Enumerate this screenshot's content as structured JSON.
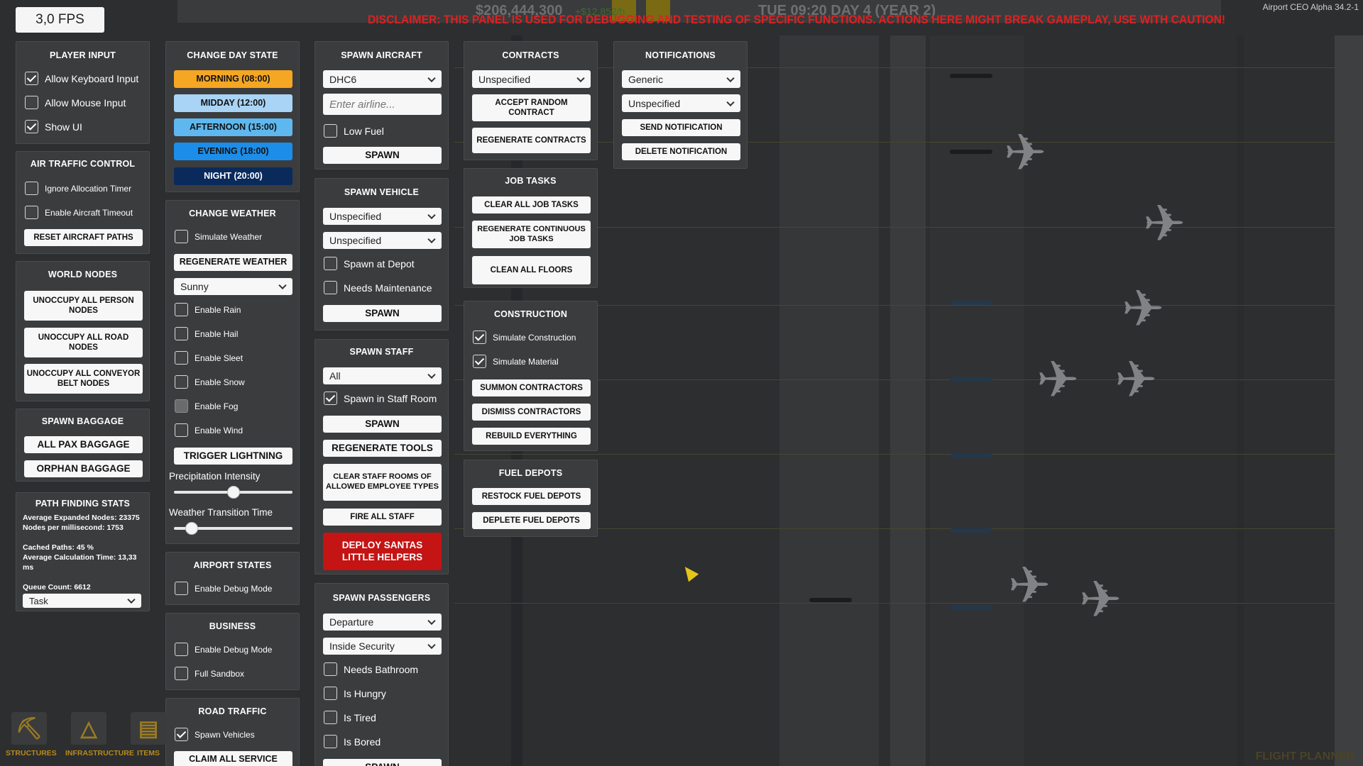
{
  "fps": "3,0 FPS",
  "hud": {
    "money": "$206,444,300",
    "income": "+$12,852/h",
    "time": "TUE  09:20  DAY 4 (YEAR 2)",
    "version": "Airport CEO Alpha 34.2-1",
    "disclaimer": "DISCLAIMER: THIS PANEL IS USED FOR DEBUGGING AND TESTING OF SPECIFIC FUNCTIONS. ACTIONS HERE MIGHT BREAK GAMEPLAY, USE WITH CAUTION!"
  },
  "player_input": {
    "title": "PLAYER INPUT",
    "allow_keyboard": "Allow Keyboard Input",
    "allow_mouse": "Allow Mouse Input",
    "show_ui": "Show UI"
  },
  "atc": {
    "title": "AIR TRAFFIC CONTROL",
    "ignore_timer": "Ignore Allocation Timer",
    "enable_timeout": "Enable Aircraft Timeout",
    "reset_paths": "RESET AIRCRAFT PATHS"
  },
  "world_nodes": {
    "title": "WORLD NODES",
    "person": "UNOCCUPY ALL PERSON NODES",
    "road": "UNOCCUPY ALL ROAD NODES",
    "conveyor": "UNOCCUPY ALL CONVEYOR BELT NODES"
  },
  "spawn_baggage": {
    "title": "SPAWN BAGGAGE",
    "all_pax": "ALL PAX BAGGAGE",
    "orphan": "ORPHAN BAGGAGE"
  },
  "pathfinding": {
    "title": "PATH FINDING STATS",
    "expanded": "Average Expanded Nodes: 23375",
    "per_ms": "Nodes per millisecond: 1753",
    "cached": "Cached Paths: 45 %",
    "calc_time_1": "Average Calculation Time: 13,33",
    "calc_time_2": "ms",
    "queue": "Queue Count: 6612",
    "dropdown": "Task"
  },
  "day_state": {
    "title": "CHANGE DAY STATE",
    "morning": "MORNING  (08:00)",
    "midday": "MIDDAY  (12:00)",
    "afternoon": "AFTERNOON  (15:00)",
    "evening": "EVENING  (18:00)",
    "night": "NIGHT (20:00)"
  },
  "weather": {
    "title": "CHANGE WEATHER",
    "simulate": "Simulate Weather",
    "regenerate": "REGENERATE WEATHER",
    "dropdown": "Sunny",
    "rain": "Enable Rain",
    "hail": "Enable Hail",
    "sleet": "Enable Sleet",
    "snow": "Enable Snow",
    "fog": "Enable Fog",
    "wind": "Enable Wind",
    "lightning": "TRIGGER LIGHTNING",
    "precip_label": "Precipitation Intensity",
    "precip_value": 0.5,
    "transition_label": "Weather Transition Time",
    "transition_value": 0.15
  },
  "airport_states": {
    "title": "AIRPORT STATES",
    "debug": "Enable Debug Mode"
  },
  "business": {
    "title": "BUSINESS",
    "debug": "Enable Debug Mode",
    "sandbox": "Full Sandbox"
  },
  "road_traffic": {
    "title": "ROAD TRAFFIC",
    "spawn_vehicles": "Spawn Vehicles",
    "claim": "CLAIM ALL SERVICE"
  },
  "spawn_aircraft": {
    "title": "SPAWN AIRCRAFT",
    "dropdown": "DHC6",
    "placeholder": "Enter airline...",
    "low_fuel": "Low Fuel",
    "spawn": "SPAWN"
  },
  "spawn_vehicle": {
    "title": "SPAWN VEHICLE",
    "dropdown1": "Unspecified",
    "dropdown2": "Unspecified",
    "at_depot": "Spawn at Depot",
    "maintenance": "Needs Maintenance",
    "spawn": "SPAWN"
  },
  "spawn_staff": {
    "title": "SPAWN STAFF",
    "dropdown": "All",
    "staff_room": "Spawn in Staff Room",
    "spawn": "SPAWN",
    "regen_tools": "REGENERATE TOOLS",
    "clear_rooms": "CLEAR STAFF ROOMS OF ALLOWED EMPLOYEE TYPES",
    "fire_all": "FIRE ALL STAFF",
    "santa": "DEPLOY SANTAS LITTLE HELPERS"
  },
  "spawn_passengers": {
    "title": "SPAWN PASSENGERS",
    "dropdown1": "Departure",
    "dropdown2": "Inside Security",
    "bathroom": "Needs Bathroom",
    "hungry": "Is Hungry",
    "tired": "Is Tired",
    "bored": "Is Bored",
    "spawn": "SPAWN"
  },
  "contracts": {
    "title": "CONTRACTS",
    "dropdown": "Unspecified",
    "accept": "ACCEPT RANDOM CONTRACT",
    "regenerate": "REGENERATE CONTRACTS"
  },
  "job_tasks": {
    "title": "JOB TASKS",
    "clear": "CLEAR ALL JOB TASKS",
    "regen": "REGENERATE CONTINUOUS JOB TASKS",
    "floors": "CLEAN ALL FLOORS"
  },
  "construction": {
    "title": "CONSTRUCTION",
    "simulate": "Simulate Construction",
    "material": "Simulate Material",
    "summon": "SUMMON CONTRACTORS",
    "dismiss": "DISMISS CONTRACTORS",
    "rebuild": "REBUILD EVERYTHING"
  },
  "fuel_depots": {
    "title": "FUEL DEPOTS",
    "restock": "RESTOCK FUEL DEPOTS",
    "deplete": "DEPLETE FUEL DEPOTS"
  },
  "notifications": {
    "title": "NOTIFICATIONS",
    "dropdown1": "Generic",
    "dropdown2": "Unspecified",
    "send": "SEND NOTIFICATION",
    "delete": "DELETE NOTIFICATION"
  },
  "bottom_bar": {
    "structures": "STRUCTURES",
    "infrastructure": "INFRASTRUCTURE",
    "items": "ITEMS",
    "flight_planner": "FLIGHT PLANNER"
  },
  "colors": {
    "morning": "#f5a623",
    "midday": "#a9d4f5",
    "afternoon": "#5eb8ef",
    "evening": "#1c8de8",
    "night": "#0a2a5c",
    "santa": "#c41414",
    "disclaimer": "#e02020"
  }
}
